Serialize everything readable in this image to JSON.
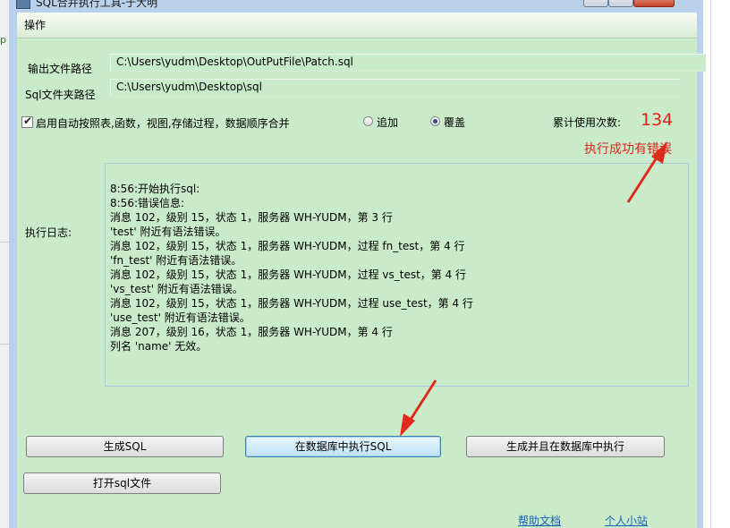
{
  "window": {
    "title": "SQL合并执行工具-于大明"
  },
  "menu": {
    "items": [
      "操作"
    ]
  },
  "form": {
    "output_path_label": "输出文件路径",
    "output_path_value": "C:\\Users\\yudm\\Desktop\\OutPutFile\\Patch.sql",
    "sql_folder_label": "Sql文件夹路径",
    "sql_folder_value": "C:\\Users\\yudm\\Desktop\\sql",
    "auto_merge_label": "启用自动按照表,函数，视图,存储过程，数据顺序合并",
    "auto_merge_checked": true,
    "radio_append_label": "追加",
    "radio_overwrite_label": "覆盖",
    "radio_selected": "覆盖",
    "usage_label": "累计使用次数:",
    "usage_count": "134",
    "status_text": "执行成功有错误"
  },
  "log": {
    "label": "执行日志:",
    "lines": [
      "8:56:开始执行sql:",
      "8:56:错误信息:",
      "消息 102，级别 15，状态 1，服务器 WH-YUDM，第 3 行",
      "'test' 附近有语法错误。",
      "消息 102，级别 15，状态 1，服务器 WH-YUDM，过程 fn_test，第 4 行",
      "'fn_test' 附近有语法错误。",
      "消息 102，级别 15，状态 1，服务器 WH-YUDM，过程 vs_test，第 4 行",
      "'vs_test' 附近有语法错误。",
      "消息 102，级别 15，状态 1，服务器 WH-YUDM，过程 use_test，第 4 行",
      "'use_test' 附近有语法错误。",
      "消息 207，级别 16，状态 1，服务器 WH-YUDM，第 4 行",
      "列名 'name' 无效。"
    ]
  },
  "buttons": {
    "generate_sql": "生成SQL",
    "execute_in_db": "在数据库中执行SQL",
    "generate_and_execute": "生成并且在数据库中执行",
    "open_sql_file": "打开sql文件"
  },
  "links": {
    "help": "帮助文档",
    "personal_site": "个人小站"
  },
  "colors": {
    "client_bg": "#c9ebc9",
    "accent_red": "#e0241b",
    "link_blue": "#1a5fb4"
  }
}
